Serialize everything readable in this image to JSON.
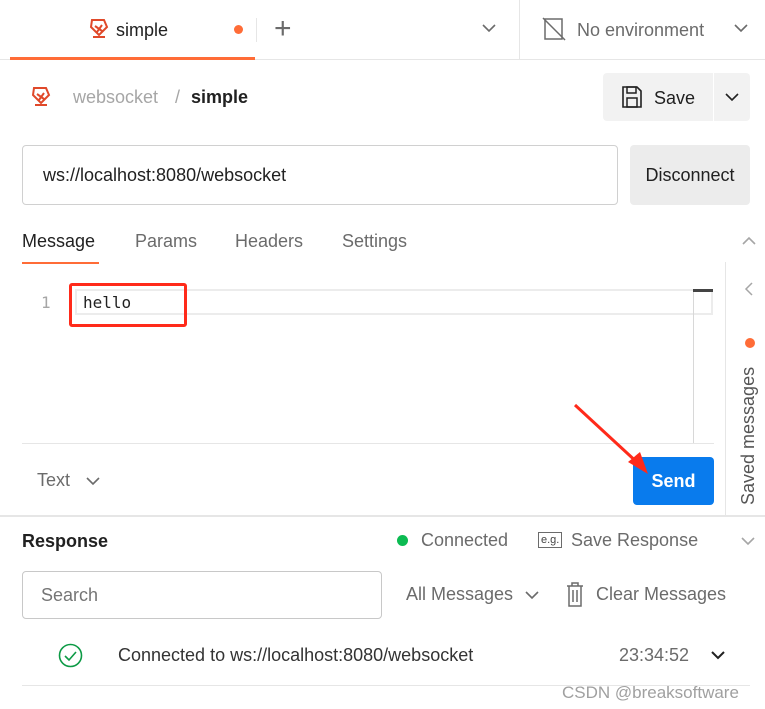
{
  "tabs": {
    "active_tab": "simple",
    "new_tab": "+",
    "environment": "No environment"
  },
  "breadcrumb": {
    "collection": "websocket",
    "separator": "/",
    "request": "simple"
  },
  "save": {
    "label": "Save"
  },
  "url": {
    "value": "ws://localhost:8080/websocket",
    "action": "Disconnect"
  },
  "request_tabs": [
    "Message",
    "Params",
    "Headers",
    "Settings"
  ],
  "editor": {
    "line_number": "1",
    "content": "hello",
    "format": "Text",
    "send": "Send"
  },
  "saved_messages": "Saved messages",
  "response": {
    "title": "Response",
    "status": "Connected",
    "save_response": "Save Response",
    "eg": "e.g.",
    "search_placeholder": "Search",
    "filter": "All Messages",
    "clear": "Clear Messages"
  },
  "messages": [
    {
      "text": "Connected to ws://localhost:8080/websocket",
      "time": "23:34:52"
    }
  ],
  "watermark": "CSDN @breaksoftware",
  "colors": {
    "accent": "#ff6c37",
    "send": "#097bed",
    "connected": "#0cbb52",
    "annotation": "#ff2a1a"
  }
}
